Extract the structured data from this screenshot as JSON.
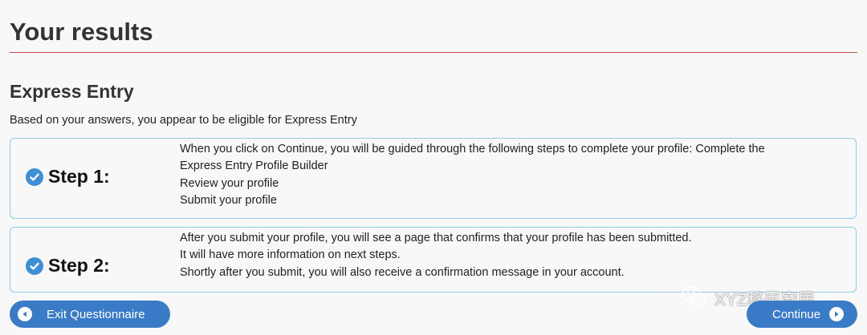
{
  "page": {
    "title": "Your results",
    "section_title": "Express Entry",
    "intro": "Based on your answers, you appear to be eligible for Express Entry"
  },
  "steps": [
    {
      "label": "Step 1:",
      "lines": [
        "When you click on Continue, you will be guided through the following steps to complete your profile: Complete the",
        "Express Entry Profile Builder",
        "Review your profile",
        "Submit your profile"
      ]
    },
    {
      "label": "Step 2:",
      "lines": [
        "After you submit your profile, you will see a page that confirms that your profile has been submitted.",
        "It will have more information on next steps.",
        "Shortly after you submit, you will also receive a confirmation message in your account."
      ]
    }
  ],
  "buttons": {
    "exit_label": "Exit Questionnaire",
    "continue_label": "Continue"
  },
  "watermark": {
    "text": "XYZ移民安居",
    "icon": "wechat-icon"
  },
  "colors": {
    "accent": "#3a7bc8",
    "check": "#3d8fd6",
    "rule": "#c0504d",
    "box_border": "#8fcbe6"
  },
  "icons": {
    "check": "check-circle-icon",
    "back": "arrow-left-circle-icon",
    "forward": "arrow-right-circle-icon"
  }
}
